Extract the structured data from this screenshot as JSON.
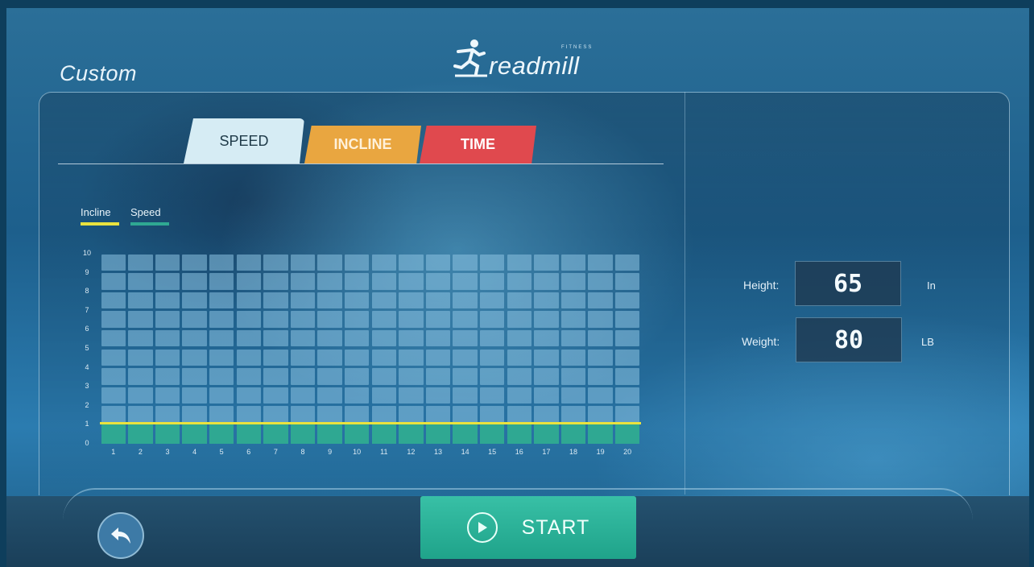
{
  "header": {
    "page_title": "Custom",
    "logo_word": "readmill",
    "logo_sub": "FITNESS"
  },
  "tabs": [
    {
      "label": "SPEED",
      "active": true
    },
    {
      "label": "INCLINE",
      "active": false
    },
    {
      "label": "TIME",
      "active": false
    }
  ],
  "legend": {
    "incline_label": "Incline",
    "speed_label": "Speed",
    "incline_color": "#e9e23e",
    "speed_color": "#2fa892"
  },
  "chart_data": {
    "type": "bar",
    "categories": [
      "1",
      "2",
      "3",
      "4",
      "5",
      "6",
      "7",
      "8",
      "9",
      "10",
      "11",
      "12",
      "13",
      "14",
      "15",
      "16",
      "17",
      "18",
      "19",
      "20"
    ],
    "series": [
      {
        "name": "Speed",
        "values": [
          1,
          1,
          1,
          1,
          1,
          1,
          1,
          1,
          1,
          1,
          1,
          1,
          1,
          1,
          1,
          1,
          1,
          1,
          1,
          1
        ]
      },
      {
        "name": "Incline",
        "values": [
          1,
          1,
          1,
          1,
          1,
          1,
          1,
          1,
          1,
          1,
          1,
          1,
          1,
          1,
          1,
          1,
          1,
          1,
          1,
          1
        ]
      }
    ],
    "y_ticks": [
      "0",
      "1",
      "2",
      "3",
      "4",
      "5",
      "6",
      "7",
      "8",
      "9",
      "10"
    ],
    "ylim": [
      0,
      10
    ],
    "grid": true,
    "legend_position": "top-left"
  },
  "profile": {
    "height_label": "Height:",
    "height_value": "65",
    "height_unit": "In",
    "weight_label": "Weight:",
    "weight_value": "80",
    "weight_unit": "LB"
  },
  "footer": {
    "back_icon": "back-arrow-icon",
    "start_label": "START",
    "start_icon": "play-icon"
  }
}
